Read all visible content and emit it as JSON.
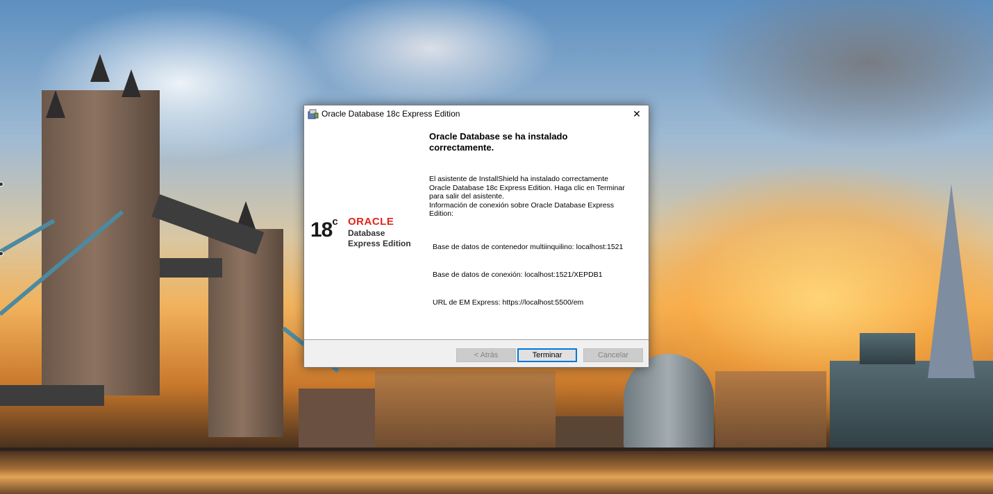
{
  "window": {
    "title": "Oracle Database 18c Express Edition",
    "close_glyph": "✕"
  },
  "logo": {
    "version": "18",
    "version_suffix": "c",
    "brand": "ORACLE",
    "line1": "Database",
    "line2": "Express Edition"
  },
  "content": {
    "heading": "Oracle Database se ha instalado correctamente.",
    "body": "El asistente de InstallShield ha instalado correctamente Oracle Database 18c Express Edition. Haga clic en Terminar para salir del asistente.",
    "connection_info": "Información de conexión sobre Oracle Database Express Edition:",
    "cdb": "Base de datos de contenedor multiinquilino: localhost:1521",
    "pdb": "Base de datos de conexión: localhost:1521/XEPDB1",
    "em": "URL de EM Express: https://localhost:5500/em"
  },
  "buttons": {
    "back": "< Atrás",
    "finish": "Terminar",
    "cancel": "Cancelar"
  },
  "icons": {
    "title": "installer-icon",
    "close": "close-icon"
  },
  "colors": {
    "oracle_red": "#e2231a",
    "focus_blue": "#0078d7"
  }
}
